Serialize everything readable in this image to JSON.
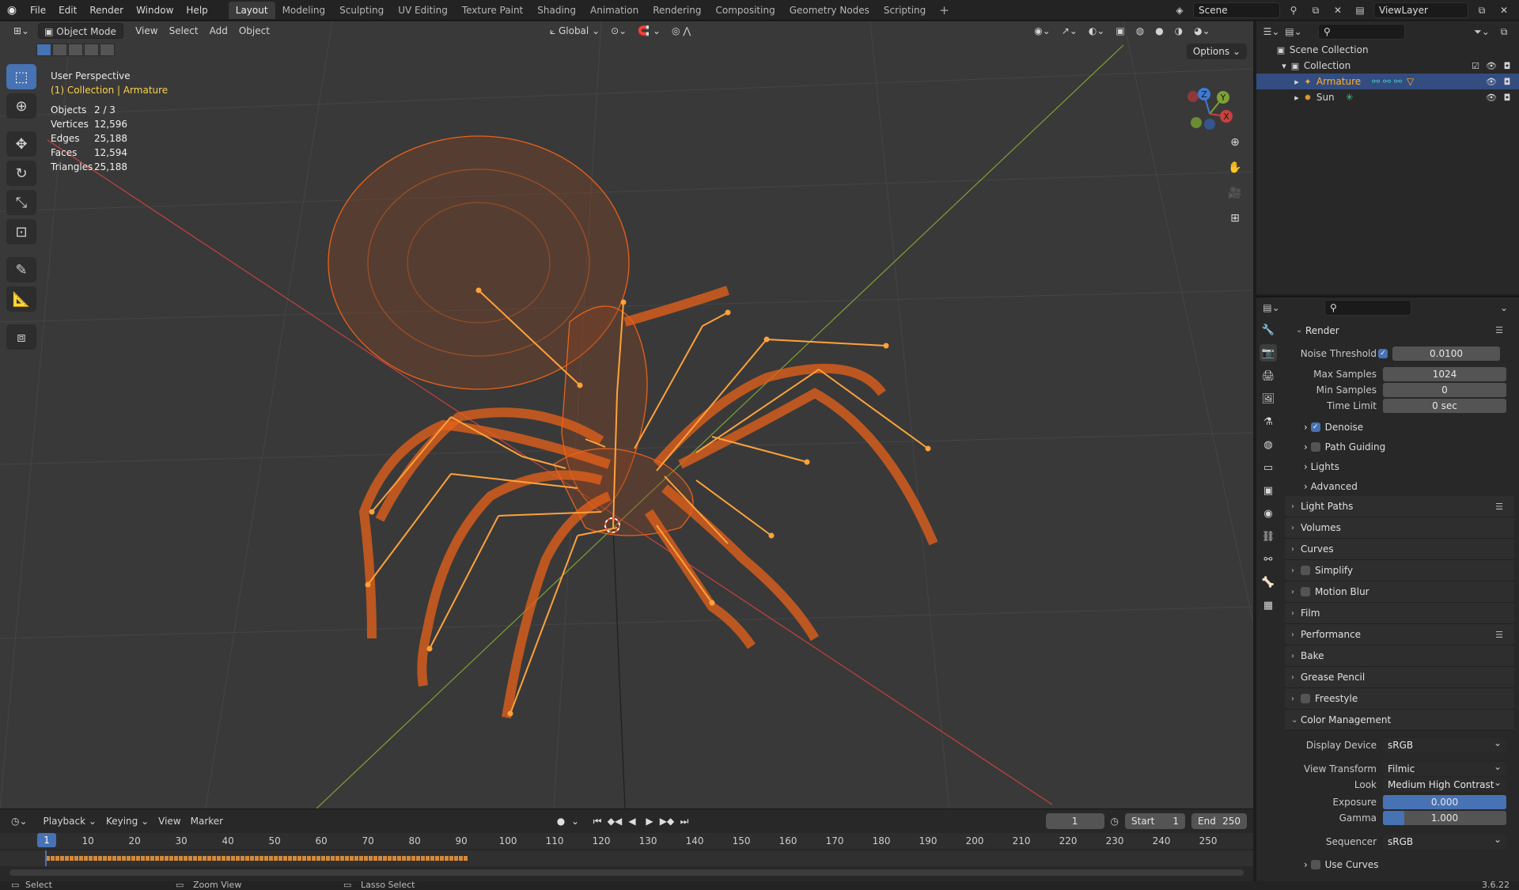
{
  "topbar": {
    "menus": [
      "File",
      "Edit",
      "Render",
      "Window",
      "Help"
    ],
    "workspaces": [
      "Layout",
      "Modeling",
      "Sculpting",
      "UV Editing",
      "Texture Paint",
      "Shading",
      "Animation",
      "Rendering",
      "Compositing",
      "Geometry Nodes",
      "Scripting"
    ],
    "active_workspace": "Layout",
    "scene": "Scene",
    "view_layer": "ViewLayer"
  },
  "viewport": {
    "mode": "Object Mode",
    "menus": [
      "View",
      "Select",
      "Add",
      "Object"
    ],
    "orientation": "Global",
    "options": "Options",
    "perspective": "User Perspective",
    "context": "(1) Collection | Armature",
    "stats": [
      {
        "label": "Objects",
        "value": "2 / 3"
      },
      {
        "label": "Vertices",
        "value": "12,596"
      },
      {
        "label": "Edges",
        "value": "25,188"
      },
      {
        "label": "Faces",
        "value": "12,594"
      },
      {
        "label": "Triangles",
        "value": "25,188"
      }
    ],
    "gizmo": {
      "x": "X",
      "y": "Y",
      "z": "Z"
    },
    "colors": {
      "selection": "#e8621a",
      "bone": "#ffa23a",
      "x_axis": "#c8413d",
      "y_axis": "#7ea136"
    }
  },
  "timeline": {
    "menus": [
      "Playback",
      "Keying",
      "View",
      "Marker"
    ],
    "current_frame": "1",
    "start_label": "Start",
    "start": "1",
    "end_label": "End",
    "end": "250",
    "ticks": [
      "10",
      "20",
      "30",
      "40",
      "50",
      "60",
      "70",
      "80",
      "90",
      "100",
      "110",
      "120",
      "130",
      "140",
      "150",
      "160",
      "170",
      "180",
      "190",
      "200",
      "210",
      "220",
      "230",
      "240",
      "250"
    ],
    "ruler_frame": "1"
  },
  "statusbar": {
    "select": "Select",
    "zoom": "Zoom View",
    "lasso": "Lasso Select",
    "version": "3.6.22"
  },
  "outliner": {
    "scene_collection": "Scene Collection",
    "collection": "Collection",
    "armature": "Armature",
    "sun": "Sun"
  },
  "properties": {
    "render_panel": "Render",
    "noise_threshold_label": "Noise Threshold",
    "noise_threshold": "0.0100",
    "max_samples_label": "Max Samples",
    "max_samples": "1024",
    "min_samples_label": "Min Samples",
    "min_samples": "0",
    "time_limit_label": "Time Limit",
    "time_limit": "0 sec",
    "denoise": "Denoise",
    "path_guiding": "Path Guiding",
    "lights": "Lights",
    "advanced": "Advanced",
    "panels": [
      "Light Paths",
      "Volumes",
      "Curves",
      "Simplify",
      "Motion Blur",
      "Film",
      "Performance",
      "Bake",
      "Grease Pencil",
      "Freestyle"
    ],
    "color_management": "Color Management",
    "display_device_label": "Display Device",
    "display_device": "sRGB",
    "view_transform_label": "View Transform",
    "view_transform": "Filmic",
    "look_label": "Look",
    "look": "Medium High Contrast",
    "exposure_label": "Exposure",
    "exposure": "0.000",
    "gamma_label": "Gamma",
    "gamma": "1.000",
    "sequencer_label": "Sequencer",
    "sequencer": "sRGB",
    "use_curves": "Use Curves"
  }
}
